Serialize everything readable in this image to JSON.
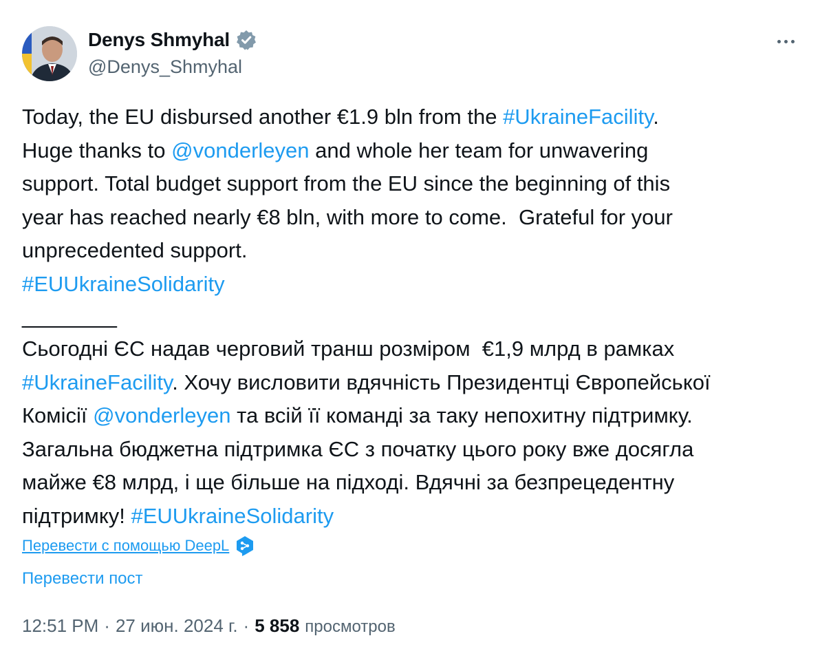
{
  "author": {
    "display_name": "Denys Shmyhal",
    "handle": "@Denys_Shmyhal",
    "verified_icon": "verified-badge-icon",
    "avatar_icon": "avatar"
  },
  "post": {
    "en": {
      "line1_pre": "Today, the EU disbursed another €1.9 bln from the ",
      "line1_tag": "#UkraineFacility",
      "line1_post": ".",
      "line2_pre": "Huge thanks to ",
      "line2_mention": "@vonderleyen",
      "line2_post": " and whole her team for unwavering",
      "line3": "support. Total budget support from the EU since the beginning of this",
      "line4": "year has reached nearly €8 bln, with more to come.  Grateful for your",
      "line5": "unprecedented support.",
      "line6_tag": "#EUUkraineSolidarity"
    },
    "separator": "________",
    "uk": {
      "line1": "Сьогодні ЄС надав черговий транш розміром  €1,9 млрд в рамках",
      "line2_tag": "#UkraineFacility",
      "line2_post": ". Хочу висловити вдячність Президентці Європейської",
      "line3_pre": "Комісії ",
      "line3_mention": "@vonderleyen",
      "line3_post": " та всій її команді за таку непохитну підтримку.",
      "line4": "Загальна бюджетна підтримка ЄС з початку цього року вже досягла",
      "line5": "майже €8 млрд, і ще більше на підході. Вдячні за безпрецедентну",
      "line6_pre": "підтримку! ",
      "line6_tag": "#EUUkraineSolidarity"
    }
  },
  "translate": {
    "deepl_label": "Перевести с помощью DeepL",
    "deepl_icon": "deepl-icon",
    "post_label": "Перевести пост"
  },
  "meta": {
    "time": "12:51 PM",
    "sep1": "·",
    "date": "27 июн. 2024 г.",
    "sep2": "·",
    "views_count": "5 858",
    "views_label": "просмотров"
  },
  "colors": {
    "link": "#1d9bf0",
    "text": "#0f1419",
    "secondary": "#536471"
  }
}
